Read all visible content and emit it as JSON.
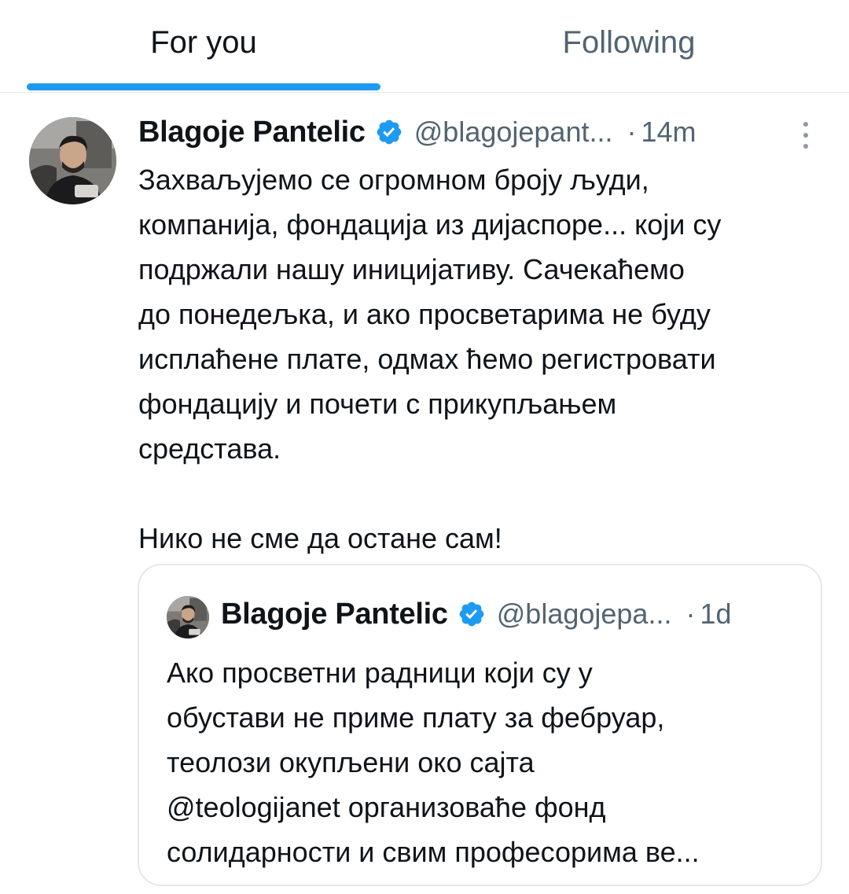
{
  "tabs": {
    "for_you": "For you",
    "following": "Following",
    "active": "for_you"
  },
  "tweet": {
    "author_name": "Blagoje Pantelic",
    "handle": "@blagojepant...",
    "separator": "·",
    "time": "14m",
    "verified": true,
    "body_lines": [
      "Захваљујемо се огромном броју људи,",
      "компанија, фондација из дијаспоре... који су",
      "подржали нашу иницијативу. Сачекаћемо",
      "до понедељка, и ако просветарима не буду",
      "исплаћене плате, одмах ћемо регистровати",
      "фондацију и почети с прикупљањем",
      "средстава."
    ],
    "closing_line": "Нико не сме да остане сам!"
  },
  "quote": {
    "author_name": "Blagoje Pantelic",
    "handle": "@blagojepa...",
    "separator": "·",
    "time": "1d",
    "verified": true,
    "body_lines": [
      "Ако просветни радници који су у",
      "обустави не приме плату за фебруар,",
      "теолози окупљени око сајта",
      "@teologijanet организоваће фонд",
      "солидарности и свим професорима ве..."
    ]
  },
  "colors": {
    "accent": "#1d9bf0",
    "text_primary": "#0f1419",
    "text_secondary": "#536471",
    "border": "#e6e9ec"
  },
  "icons": {
    "verified": "verified-badge-icon",
    "more": "more-vertical-icon"
  }
}
